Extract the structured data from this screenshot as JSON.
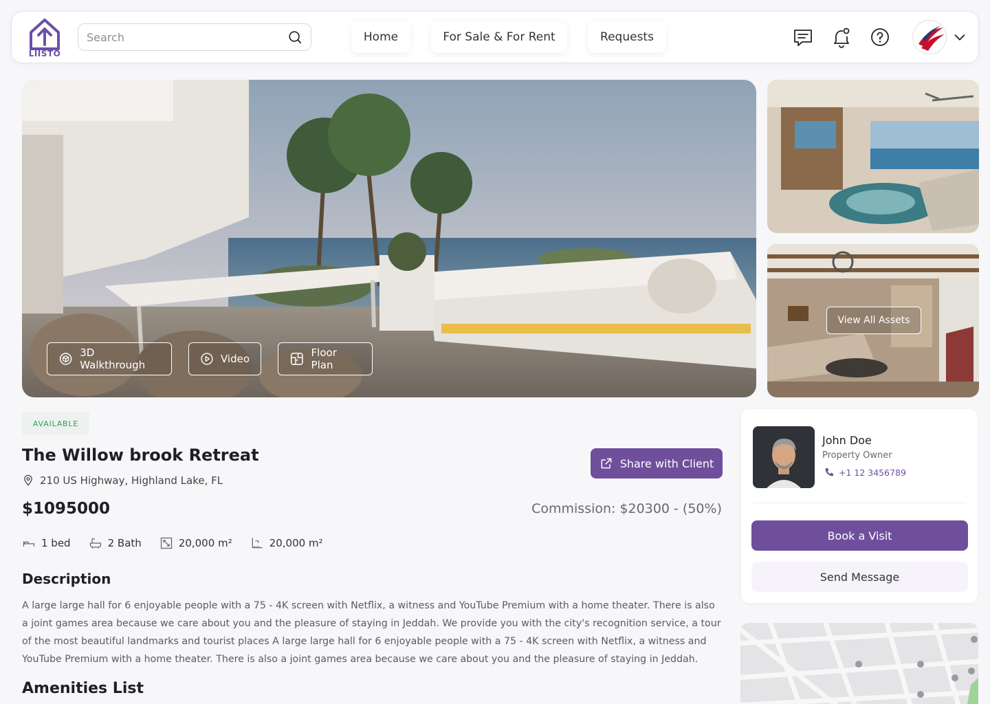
{
  "header": {
    "logo_text": "LIISTO",
    "search_placeholder": "Search",
    "nav": {
      "home": "Home",
      "sale_rent": "For Sale & For Rent",
      "requests": "Requests"
    },
    "icons": [
      "chat-icon",
      "bell-icon",
      "help-icon"
    ]
  },
  "gallery": {
    "buttons": {
      "walkthrough": "3D Walkthrough",
      "video": "Video",
      "floor_plan": "Floor Plan"
    },
    "view_all": "View All Assets"
  },
  "property": {
    "status": "AVAILABLE",
    "title": "The Willow brook Retreat",
    "address": "210 US Highway, Highland Lake, FL",
    "share_label": "Share with Client",
    "price": "$1095000",
    "commission": "Commission: $20300 - (50%)",
    "features": {
      "beds": "1 bed",
      "baths": "2 Bath",
      "area": "20,000 m²",
      "lot": "20,000 m²"
    },
    "description_heading": "Description",
    "description": "A large large hall for 6 enjoyable people with a 75 - 4K screen with Netflix, a witness and YouTube Premium with a home theater. There is also a joint games area because we care about you and the pleasure of staying in Jeddah. We provide you with the city's recognition service, a tour of the most beautiful landmarks and tourist places A large large hall for 6 enjoyable people with a 75 - 4K screen with Netflix, a witness and YouTube Premium with a home theater. There is also a joint games area because we care about you and the pleasure of staying in Jeddah.",
    "amenities_heading": "Amenities List"
  },
  "agent": {
    "name": "John Doe",
    "role": "Property Owner",
    "phone": "+1 12 3456789",
    "book_label": "Book a Visit",
    "message_label": "Send Message"
  },
  "colors": {
    "accent": "#6f4f9c",
    "status_green": "#2e9e5b",
    "background": "#f7f6f9"
  }
}
